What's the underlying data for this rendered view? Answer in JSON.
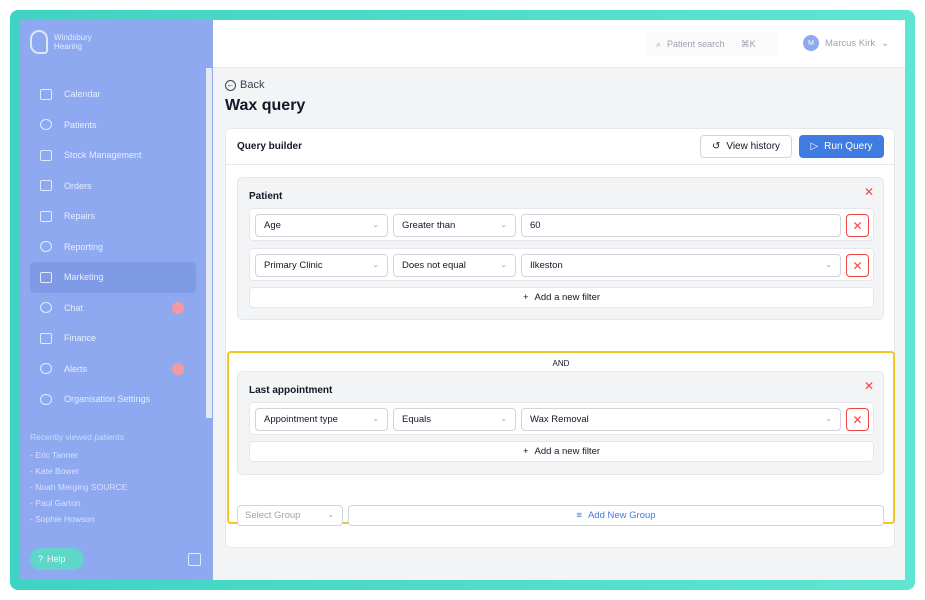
{
  "sidebar": {
    "brand_line1": "Windsbury",
    "brand_line2": "Hearing",
    "nav": [
      {
        "label": "Calendar",
        "icon": "calendar-icon"
      },
      {
        "label": "Patients",
        "icon": "patients-icon"
      },
      {
        "label": "Stock Management",
        "icon": "stock-icon"
      },
      {
        "label": "Orders",
        "icon": "orders-icon"
      },
      {
        "label": "Repairs",
        "icon": "wrench-icon"
      },
      {
        "label": "Reporting",
        "icon": "reporting-icon"
      },
      {
        "label": "Marketing",
        "icon": "mail-icon"
      },
      {
        "label": "Chat",
        "icon": "chat-icon"
      },
      {
        "label": "Finance",
        "icon": "finance-icon"
      },
      {
        "label": "Alerts",
        "icon": "bell-icon"
      },
      {
        "label": "Organisation Settings",
        "icon": "gear-icon"
      }
    ],
    "recent_title": "Recently viewed patients",
    "recent": [
      "- Eric Tanner",
      "- Kate Bower",
      "- Noah Merging SOURCE",
      "- Paul Garton",
      "- Sophie Howson"
    ],
    "help_label": "Help"
  },
  "topbar": {
    "search_label": "Patient search",
    "search_shortcut": "⌘K",
    "user_initials": "M",
    "user_name": "Marcus Kirk"
  },
  "page": {
    "back_label": "Back",
    "title": "Wax query"
  },
  "query_builder": {
    "title": "Query builder",
    "view_history_label": "View history",
    "run_query_label": "Run Query",
    "connector": "AND",
    "add_filter_label": "Add a new filter",
    "select_group_placeholder": "Select Group",
    "add_group_label": "Add New Group",
    "groups": [
      {
        "title": "Patient",
        "filters": [
          {
            "field": "Age",
            "operator": "Greater than",
            "value": "60"
          },
          {
            "field": "Primary Clinic",
            "operator": "Does not equal",
            "value": "Ilkeston"
          }
        ]
      },
      {
        "title": "Last appointment",
        "filters": [
          {
            "field": "Appointment type",
            "operator": "Equals",
            "value": "Wax Removal"
          }
        ]
      }
    ]
  },
  "colors": {
    "frame": "#3fd3c3",
    "sidebar": "#8ea9f0",
    "primary": "#3f7be0",
    "danger": "#ef4444",
    "highlight": "#f3c623"
  }
}
